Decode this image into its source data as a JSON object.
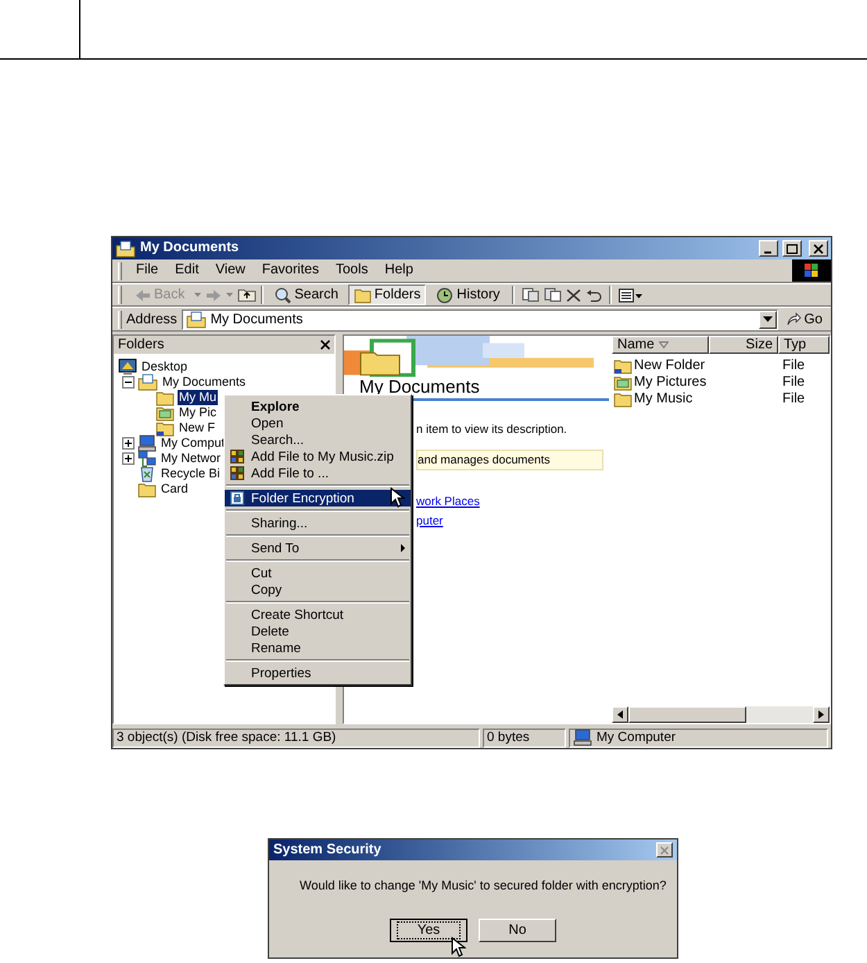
{
  "explorer": {
    "title": "My Documents",
    "menu_bar": [
      "File",
      "Edit",
      "View",
      "Favorites",
      "Tools",
      "Help"
    ],
    "toolbar": [
      {
        "label": "Back",
        "kind": "back",
        "disabled": true,
        "pressed": false
      },
      {
        "label": "Search",
        "kind": "search",
        "disabled": false,
        "pressed": false
      },
      {
        "label": "Folders",
        "kind": "folders",
        "disabled": false,
        "pressed": true
      },
      {
        "label": "History",
        "kind": "history",
        "disabled": false,
        "pressed": false
      }
    ],
    "address": {
      "label": "Address",
      "value": "My Documents",
      "go": "Go"
    },
    "folders_pane": {
      "title": "Folders",
      "tree": [
        {
          "label": "Desktop",
          "kind": "desktop",
          "selected": false,
          "children": [
            {
              "label": "My Documents",
              "kind": "docs",
              "selected": false,
              "expanded": true,
              "children": [
                {
                  "label": "My Mu",
                  "kind": "folder",
                  "selected": true
                },
                {
                  "label": "My Pic",
                  "kind": "pictures",
                  "selected": false
                },
                {
                  "label": "New F",
                  "kind": "newfolder",
                  "selected": false
                }
              ]
            },
            {
              "label": "My Comput",
              "kind": "computer",
              "selected": false,
              "expanded": false
            },
            {
              "label": "My Networ",
              "kind": "network",
              "selected": false,
              "expanded": false
            },
            {
              "label": "Recycle Bi",
              "kind": "recycle",
              "selected": false
            },
            {
              "label": "Card",
              "kind": "folder",
              "selected": false
            }
          ]
        }
      ]
    },
    "web_view": {
      "heading": "My Documents",
      "description": "n item to view its description.",
      "info": "and manages documents",
      "links": [
        "work Places",
        "puter"
      ]
    },
    "list": {
      "columns": [
        "Name",
        "Size",
        "Typ"
      ],
      "rows": [
        {
          "name": "New Folder",
          "kind": "newfolder",
          "type": "File"
        },
        {
          "name": "My Pictures",
          "kind": "pictures",
          "type": "File"
        },
        {
          "name": "My Music",
          "kind": "folder",
          "type": "File"
        }
      ]
    },
    "status_bar": [
      "3 object(s) (Disk free space: 11.1 GB)",
      "0 bytes",
      "My Computer"
    ]
  },
  "context_menu": [
    {
      "label": "Explore",
      "kind": "item",
      "default": true,
      "selected": false
    },
    {
      "label": "Open",
      "kind": "item",
      "default": false,
      "selected": false
    },
    {
      "label": "Search...",
      "kind": "item",
      "default": false,
      "selected": false
    },
    {
      "label": "Add File to My Music.zip",
      "kind": "zip",
      "default": false,
      "selected": false
    },
    {
      "label": "Add File to ...",
      "kind": "zip",
      "default": false,
      "selected": false
    },
    {
      "kind": "separator"
    },
    {
      "label": "Folder Encryption",
      "kind": "lock",
      "default": false,
      "selected": true
    },
    {
      "kind": "separator"
    },
    {
      "label": "Sharing...",
      "kind": "item",
      "default": false,
      "selected": false
    },
    {
      "kind": "separator"
    },
    {
      "label": "Send To",
      "kind": "submenu",
      "default": false,
      "selected": false
    },
    {
      "kind": "separator"
    },
    {
      "label": "Cut",
      "kind": "item",
      "default": false,
      "selected": false
    },
    {
      "label": "Copy",
      "kind": "item",
      "default": false,
      "selected": false
    },
    {
      "kind": "separator"
    },
    {
      "label": "Create Shortcut",
      "kind": "item",
      "default": false,
      "selected": false
    },
    {
      "label": "Delete",
      "kind": "item",
      "default": false,
      "selected": false
    },
    {
      "label": "Rename",
      "kind": "item",
      "default": false,
      "selected": false
    },
    {
      "kind": "separator"
    },
    {
      "label": "Properties",
      "kind": "item",
      "default": false,
      "selected": false
    }
  ],
  "dialog": {
    "title": "System Security",
    "message": "Would like to change 'My Music' to secured folder with encryption?",
    "buttons": [
      {
        "label": "Yes",
        "selected": true
      },
      {
        "label": "No",
        "selected": false
      }
    ]
  }
}
